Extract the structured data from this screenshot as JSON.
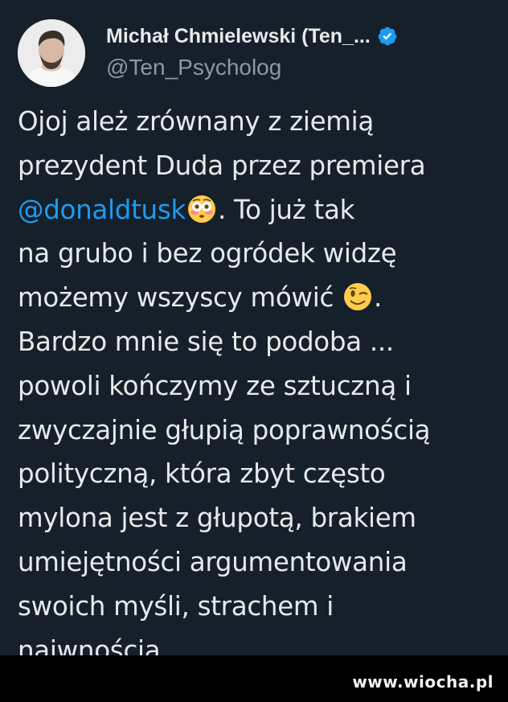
{
  "author": {
    "name": "Michał Chmielewski (Ten_...",
    "handle": "@Ten_Psycholog",
    "verified_color": "#1d9bf0"
  },
  "tweet": {
    "line1": "Ojoj ależ zrównany z ziemią",
    "line2": "prezydent Duda przez premiera",
    "line3_mention": "@donaldtusk",
    "line3_rest": ". To już tak",
    "line4": "na grubo i bez ogródek widzę",
    "line5_start": "możemy wszyscy mówić ",
    "line5_end": ".",
    "line6": "Bardzo mnie się to podoba ...",
    "line7": "powoli kończymy ze sztuczną i",
    "line8": "zwyczajnie głupią poprawnością",
    "line9": "polityczną, która zbyt często",
    "line10": "mylona jest z głupotą, brakiem",
    "line11": "umiejętności argumentowania",
    "line12": "swoich myśli, strachem i",
    "line13": "naiwnością.",
    "emoji1": "flushed-face",
    "emoji2": "winking-face"
  },
  "watermark": "www.wiocha.pl",
  "colors": {
    "background": "#15202b",
    "text": "#e7e9ea",
    "secondary": "#8b98a5",
    "mention": "#1d9bf0"
  }
}
